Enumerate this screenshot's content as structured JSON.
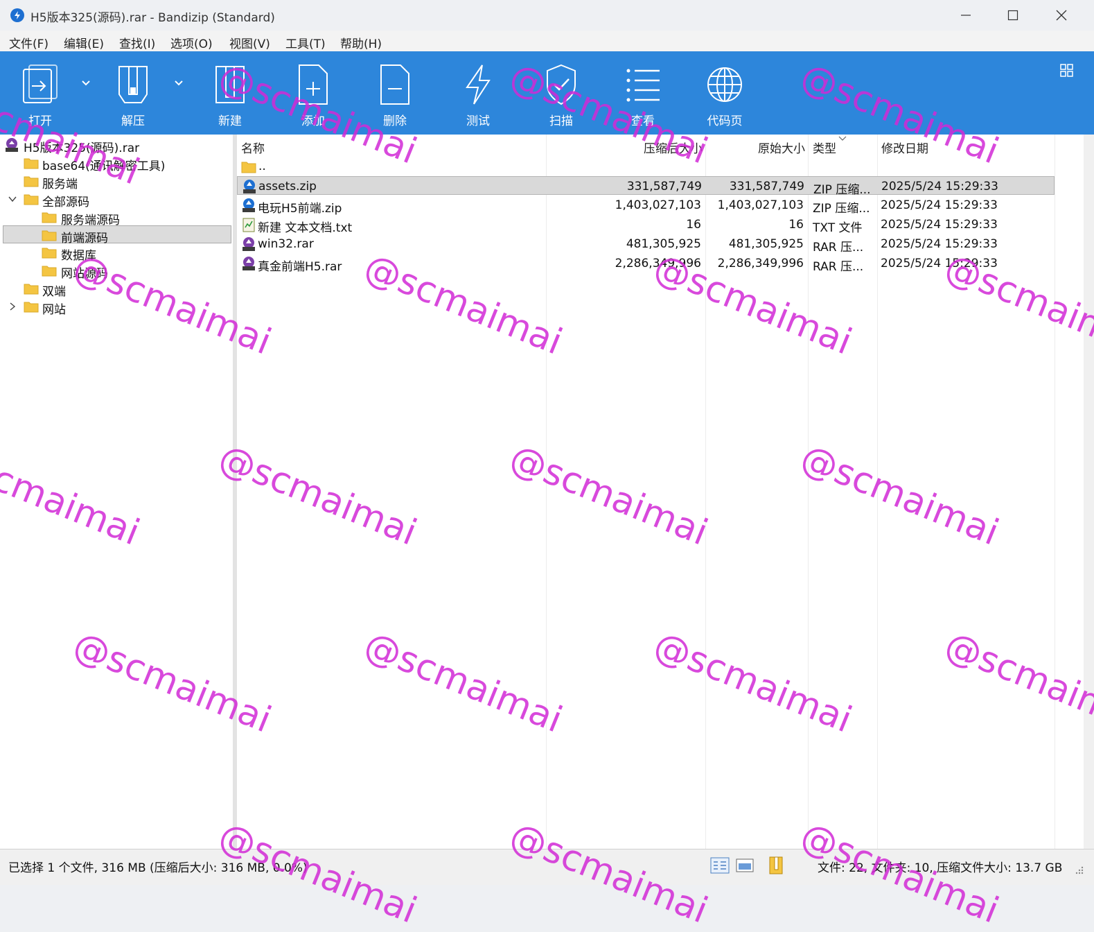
{
  "window": {
    "title": "H5版本325(源码).rar - Bandizip (Standard)"
  },
  "menu": [
    "文件(F)",
    "编辑(E)",
    "查找(I)",
    "选项(O)",
    "视图(V)",
    "工具(T)",
    "帮助(H)"
  ],
  "toolbar": {
    "open": "打开",
    "extract": "解压",
    "new": "新建",
    "add": "添加",
    "delete": "删除",
    "test": "测试",
    "scan": "扫描",
    "view": "查看",
    "codepage": "代码页"
  },
  "tree": [
    {
      "label": "H5版本325(源码).rar"
    },
    {
      "label": "base64(通讯解密工具)"
    },
    {
      "label": "服务端"
    },
    {
      "label": "全部源码"
    },
    {
      "label": "服务端源码"
    },
    {
      "label": "前端源码"
    },
    {
      "label": "数据库"
    },
    {
      "label": "网站源码"
    },
    {
      "label": "双端"
    },
    {
      "label": "网站"
    }
  ],
  "columns": {
    "name": "名称",
    "packed": "压缩后大小",
    "size": "原始大小",
    "type": "类型",
    "modified": "修改日期"
  },
  "files": [
    {
      "name": "..",
      "packed": "",
      "size": "",
      "type": "",
      "modified": ""
    },
    {
      "name": "assets.zip",
      "packed": "331,587,749",
      "size": "331,587,749",
      "type": "ZIP 压缩...",
      "modified": "2025/5/24 15:29:33"
    },
    {
      "name": "电玩H5前端.zip",
      "packed": "1,403,027,103",
      "size": "1,403,027,103",
      "type": "ZIP 压缩...",
      "modified": "2025/5/24 15:29:33"
    },
    {
      "name": "新建 文本文档.txt",
      "packed": "16",
      "size": "16",
      "type": "TXT 文件",
      "modified": "2025/5/24 15:29:33"
    },
    {
      "name": "win32.rar",
      "packed": "481,305,925",
      "size": "481,305,925",
      "type": "RAR 压...",
      "modified": "2025/5/24 15:29:33"
    },
    {
      "name": "真金前端H5.rar",
      "packed": "2,286,349,996",
      "size": "2,286,349,996",
      "type": "RAR 压...",
      "modified": "2025/5/24 15:29:33"
    }
  ],
  "status": {
    "left": "已选择 1 个文件, 316 MB (压缩后大小: 316 MB, 0.0%)",
    "right": "文件: 22, 文件夹: 10, 压缩文件大小: 13.7 GB"
  },
  "watermark": "@scmaimai",
  "colors": {
    "toolbar": "#2d86db",
    "watermark": "#d22ad6",
    "folder": "#f4c542"
  }
}
